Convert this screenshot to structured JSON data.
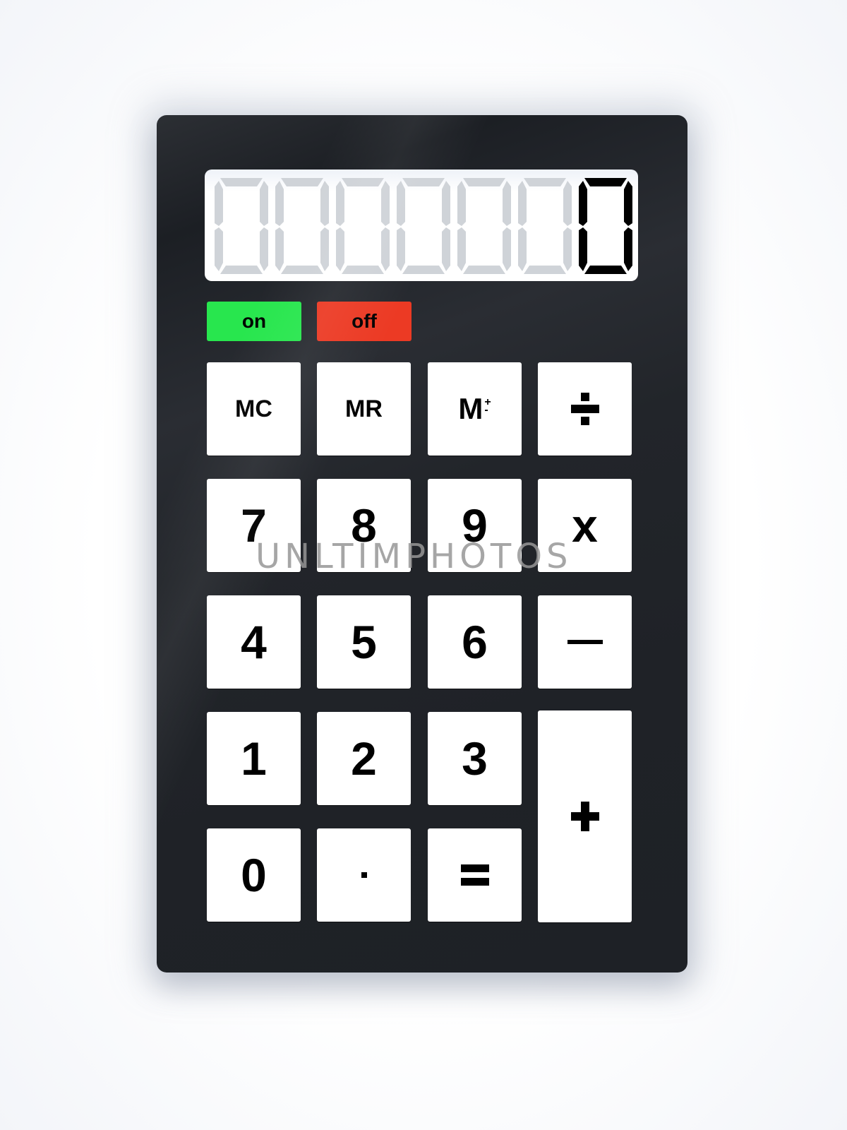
{
  "display": {
    "value": "0",
    "digit_slots": 7,
    "ghost_color": "#cfd3d8",
    "active_color": "#000000"
  },
  "power": {
    "on_label": "on",
    "off_label": "off",
    "on_color": "#28e64e",
    "off_color": "#ec3a24"
  },
  "keys": {
    "mc": "MC",
    "mr": "MR",
    "m_plus_minus": "M",
    "m_plus_minus_sup": "+",
    "m_plus_minus_sub": "-",
    "divide": "÷",
    "seven": "7",
    "eight": "8",
    "nine": "9",
    "multiply": "x",
    "four": "4",
    "five": "5",
    "six": "6",
    "minus": "—",
    "one": "1",
    "two": "2",
    "three": "3",
    "plus": "+",
    "zero": "0",
    "decimal": "·",
    "equals": "="
  },
  "watermark": "UNLTIMPHOTOS"
}
